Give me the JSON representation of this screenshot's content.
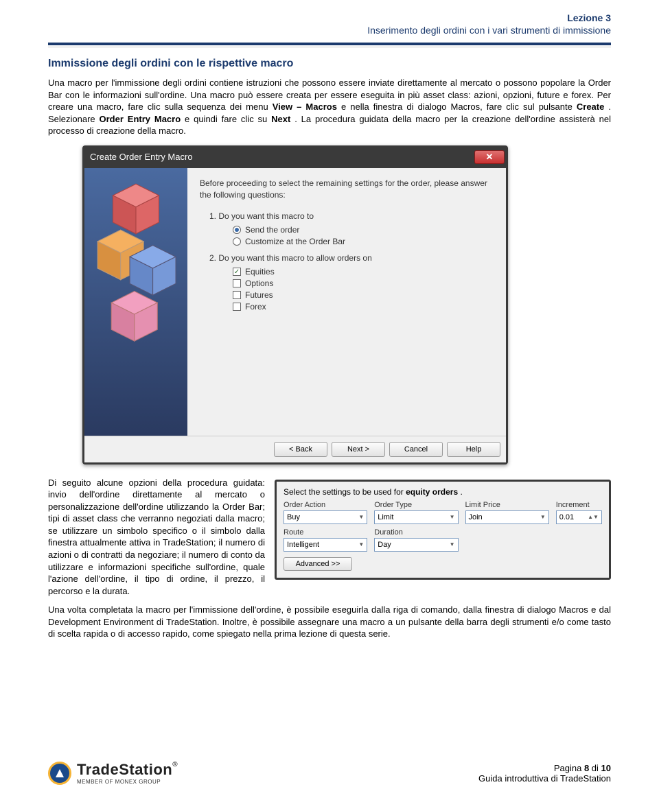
{
  "header": {
    "lesson": "Lezione 3",
    "subtitle": "Inserimento degli ordini con i vari strumenti di immissione"
  },
  "section_title": "Immissione degli ordini con le rispettive macro",
  "para1_a": "Una macro per l'immissione degli ordini contiene istruzioni che possono essere inviate direttamente al mercato o possono popolare la Order Bar con le informazioni sull'ordine. Una macro può essere creata per essere eseguita in più asset class: azioni, opzioni, future e forex. Per creare una macro, fare clic sulla sequenza dei menu ",
  "para1_b": "View – Macros",
  "para1_c": " e nella finestra di dialogo Macros, fare clic sul pulsante ",
  "para1_d": "Create",
  "para1_e": ". Selezionare ",
  "para1_f": "Order Entry Macro",
  "para1_g": " e quindi fare clic su ",
  "para1_h": "Next",
  "para1_i": ". La procedura guidata della macro per la creazione dell'ordine assisterà nel processo di creazione della macro.",
  "dialog1": {
    "title": "Create Order Entry Macro",
    "intro": "Before proceeding to select the remaining settings for the order, please answer the following questions:",
    "q1": "1. Do you want this macro to",
    "q1_opts": [
      "Send the order",
      "Customize at the Order Bar"
    ],
    "q2": "2. Do you want this macro to allow orders on",
    "q2_opts": [
      "Equities",
      "Options",
      "Futures",
      "Forex"
    ],
    "buttons": {
      "back": "< Back",
      "next": "Next >",
      "cancel": "Cancel",
      "help": "Help"
    }
  },
  "para2": "Di seguito alcune opzioni della procedura guidata: invio dell'ordine direttamente al mercato o personalizzazione dell'ordine utilizzando la Order Bar; tipi di asset class che verranno negoziati dalla macro; se utilizzare un simbolo specifico o il simbolo dalla finestra attualmente attiva in TradeStation; il numero di azioni o di contratti da negoziare; il numero di conto da utilizzare e informazioni specifiche sull'ordine, quale l'azione dell'ordine, il tipo di ordine, il prezzo, il percorso e la durata.",
  "para3": "Una volta completata la macro per l'immissione dell'ordine, è possibile eseguirla dalla riga di comando, dalla finestra di dialogo Macros e dal Development Environment di TradeStation. Inoltre, è possibile assegnare una macro a un pulsante della barra degli strumenti e/o come tasto di scelta rapida o di accesso rapido, come spiegato nella prima lezione di questa serie.",
  "panel": {
    "title_a": "Select the settings to be used for ",
    "title_b": "equity orders",
    "title_c": ".",
    "fields": {
      "action": {
        "label": "Order Action",
        "value": "Buy"
      },
      "type": {
        "label": "Order Type",
        "value": "Limit"
      },
      "limit": {
        "label": "Limit Price",
        "value": "Join"
      },
      "incr": {
        "label": "Increment",
        "value": "0.01"
      },
      "route": {
        "label": "Route",
        "value": "Intelligent"
      },
      "dur": {
        "label": "Duration",
        "value": "Day"
      }
    },
    "advanced": "Advanced >>"
  },
  "footer": {
    "brand": "TradeStation",
    "reg": "®",
    "member": "MEMBER OF MONEX GROUP",
    "page_a": "Pagina ",
    "page_b": "8",
    "page_c": " di ",
    "page_d": "10",
    "guide": "Guida introduttiva di TradeStation"
  }
}
